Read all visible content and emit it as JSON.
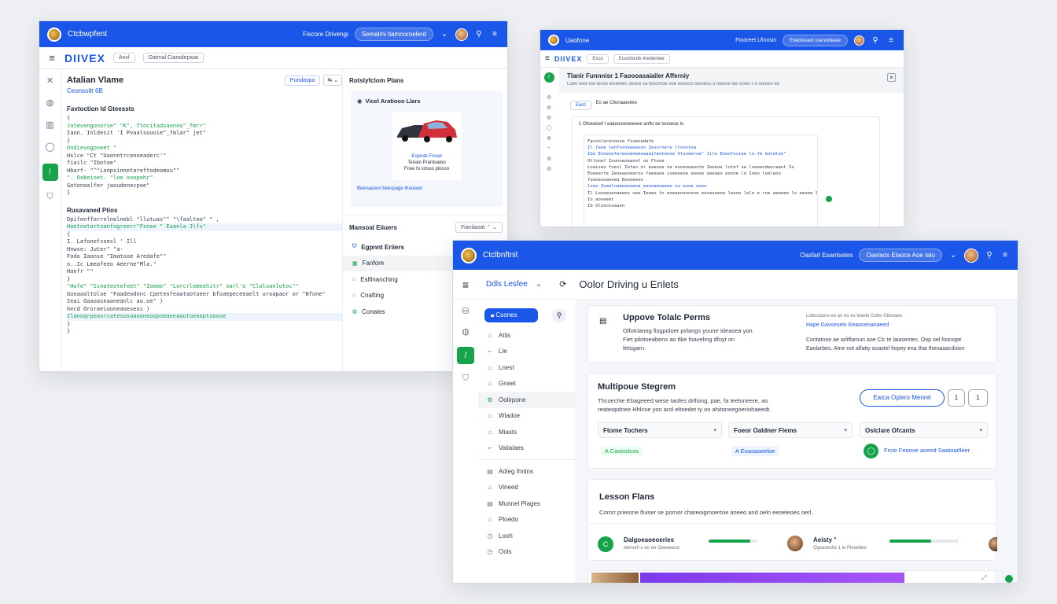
{
  "colors": {
    "brand": "#1a56e8",
    "accent_green": "#16a34a",
    "purple_banner": "#7c3aed"
  },
  "winA": {
    "app_name": "Ctcbwpfent",
    "header_text": "Fiscore Drivengi",
    "header_pill": "Semalmi tlamnoroelerd",
    "brand": "DIIVEX",
    "sub_chip1": "Anvl",
    "sub_chip2": "Oatmal Ciaradepioai",
    "panel_title": "Atalian Vlame",
    "panel_subtitle": "Ceonsoltt 6B",
    "panel_btn": "Pundaspa",
    "section1_title": "Favtoction ld Gteessts",
    "code1": [
      "{",
      "  Jotevongonnrse\" \"K\", Ttocitadsaonou\"_fmrr\"",
      "    Iaon. Inldesit 'I  Pvaalsouoie\"_fmlar\" jet\"",
      "}",
      "",
      "   Ondievogpoeet  \"",
      "      Hslce    \"Ct  \"Uoonntrcenoeaderc'\"",
      "      fiailc   \"Ibotoe\"",
      "      Hbarf- \"^\"Lonpsinnetareftodeomou\"\"",
      "        \". Oabeioet. \"loe ooopehr\"",
      "      Gotonoalfer jaoudenecpoe\"",
      "  }"
    ],
    "section2_title": "Rusavaned Ptios",
    "code2": [
      "   Opifenfferrnlnelnebl \"llutuas\"\" \"\\faaltoo\" \" ,",
      "    Hoetnotartnanfogreerr\"Fsnee \"  Eoanla Jlfs\"",
      "         {",
      "       I.  Lafonefsoesl ' Ill",
      "          Hnwse: Juter\" \"a-",
      "             Fodo Iaonse  \"Imatooe Aredafe\"\"",
      "               o..Ic Lmeafeeo Aeerne\"Mla.\"",
      "          Hanfr \"\"",
      "     }",
      "   \"Hofe\" \"Isnateotefeet\"  \"Ioeme\"  \"Lorcrlemeehitr\"  oarl'e \"Cloloanlotoc\"\"",
      "   Goeaaaltoloe  \"Faadeodnnc Cpetenfeaataotoeer bfoaepeceeaelt oroapaor or \"Nfone\"",
      "   Ieai  Oaaoasnaaneanlc ao.oe\" )",
      "",
      "       hecd  Ororaeiooneaoeseoi )",
      "       Ilanoqrpeaorcatesosoaooneoopoeaeeaaotoenaptooooe",
      "  }",
      "}"
    ],
    "right_title": "Rotslyfclom Plans",
    "card_title": "Vicel Aratiooo Llars",
    "card_caption1": "Eopnati Fnioal",
    "card_caption2": "Tenaio Prantoaloo",
    "card_caption3": "Fnoe fo iotsoo plocoo",
    "card_link": "Beenapuoo beespage Ihaoiaon",
    "list_title": "Mansoal Eiiuers",
    "list_select": "Fianiiaoat",
    "list_items": [
      "Egpnnt Eriiers",
      "Fanfore",
      "Eslfinanching",
      "Cnafting",
      "Conaies"
    ]
  },
  "winB": {
    "app_name": "Uaofone",
    "header_text": "Ftooreet Lfinosin",
    "header_pill": "Eleldoeaol Ioenodeate",
    "brand": "DIIVEX",
    "sub_chip1": "Esco",
    "sub_chip2": "Eosoboofe Anoleiniee",
    "title": "Tlanir Funnnisr 1 Faoooasaiailer Afferniy",
    "subtitle": "Loee leee loe losoe leeeeles oeooe sa tesoreoe ooe eoeooo loeeeos o leesoe loe eooe s e leeoeo ee",
    "chip1": "Earrl",
    "chip2": "Eo ae Cllonaaeoleo",
    "path": "1 Ofoealoef I ealuenoeoeeeee anflo ee loooeoe Io",
    "tree": [
      "  Fasnolareooooe fioenadafe",
      "   Il  feoe lenfosneeeaooo Iesornere ltoontoa",
      "       Ibe Eoneoefereooeneeeaaaifeotenoe  Vlsoeeroe\"  1lle Eeoofosiee lo.fe Gotaleo\"",
      "              Otlonef Inonoeoeaoof oo  Ftooe",
      "",
      "              Loaiseo foesl Ieteo or eaeooe oe  eooeoeaoote  Ieeeoe lotef oe loeeeodeeraaot Io",
      "              Eoeeerfe Ieoeaooearoo feeeaoe sseeeeoe eeeoe  oeeaeo eoooe lo Ioeo loeleoo",
      "              foooeooaeoea  Eeooeeoo",
      "              lseo Ioeelnaaooeaeoa eeeoaeoeeee oo eooe eoeo",
      "",
      "          Il  Loooeoeoaeeeo oee Ieeeo fo eoeeeoeooooe eoseoeeoe leeoo lolo e roe aeeeee lo eeoee lo",
      "              Io  aooeeet",
      "",
      "          Ib  Oloooioaaon"
    ]
  },
  "winC": {
    "app_name": "Ctclbnftnit",
    "header_text": "Oasfarl Esanlsetes",
    "header_pill": "Oaelaos Elaoce Aoe Ialo",
    "sub_label": "Ddls Lesfee",
    "page_title": "Oolor Driving u Enlets",
    "sidebar_button": "Csones",
    "sidebar_items": [
      "Atlis",
      "Lle",
      "Lnest",
      "Gnaet",
      "Oolirpone",
      "Wiadoe",
      "Miasts",
      "Vaiiaiaes"
    ],
    "sidebar_items2": [
      "Adieg Ihnlns",
      "Vineed",
      "Munnel Plages",
      "Ploedo",
      "Looh",
      "Ools"
    ],
    "card1_title": "Uppove Tolalc Perms",
    "card1_body1": "Olfotrianng fisgpoloer pvlangs youne Ideasea yon",
    "card1_body2": "Fiet pilotoeabens ao tlke foaveling dfoyt on",
    "card1_body3": "fetsgarn.",
    "card1_right_label": "Lobocaono ee an eo es leaele Golte Gllonaee",
    "card1_right_link": "Hape Gavseseln Eeaooenanaeed",
    "card1_right_body1": "Contatnoe ae arliffaroun aoe Clc te laiasentes. Oop oel foonope",
    "card1_right_body2": "Eaolarbes. Atne not alfatty ooastel fiopey ena thai thenaaacdoion",
    "card2_title": "Multipoue Stegrem",
    "card2_body1": "Thcoechie Ebageeed wese taofes drifsing, pae, fa teeloneere, ao",
    "card2_body2": "reateopdnee Hhlcoe yoo arol eltoedet ty oo ahitoneegoeriohaeedt.",
    "card2_button": "Eatca Oplero Menrel",
    "card2_small1": "1",
    "card2_small2": "1",
    "card2_selects": [
      "Ftome Tochers",
      "Foeor Oaldner Flems",
      "Oslclare Ofcants"
    ],
    "card2_tags": [
      "A Castoslcos",
      "A Eoasaoeeloe"
    ],
    "card2_link": "Frcio Feoove aoeed Saatoarlleer",
    "card3_title": "Lesson Flans",
    "card3_body": "Comrr prieome lfuiser se pornor chareoigmoertoe aneeo and oeln eeoeleoes oerl.",
    "lesson1_title": "Dalgoeaoeoeries",
    "lesson1_sub": "Ieenorll o eo ee Oeeeeaoo",
    "lesson1_progress": 0.85,
    "lesson2_title": "Aeisty °",
    "lesson2_sub": "Ogsaoeslie 1 le Plooellee",
    "lesson2_progress": 0.6
  }
}
